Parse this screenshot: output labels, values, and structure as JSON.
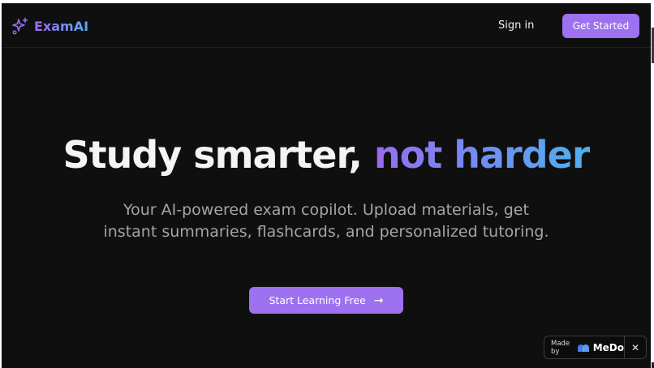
{
  "brand": {
    "name": "ExamAI",
    "icon": "sparkles-icon",
    "color": "#9b6cf2"
  },
  "nav": {
    "signin_label": "Sign in",
    "get_started_label": "Get Started"
  },
  "hero": {
    "title_main": "Study smarter, ",
    "title_accent": "not harder",
    "subtitle": "Your AI-powered exam copilot. Upload materials, get instant summaries, flashcards, and personalized tutoring.",
    "cta_label": "Start Learning Free",
    "cta_icon": "arrow-right-icon"
  },
  "badge": {
    "made_by": "Made by",
    "brand": "MeDo",
    "close": "✕"
  },
  "colors": {
    "background": "#100f10",
    "accent": "#9d71ef",
    "gradient_end": "#4fb0ef"
  }
}
